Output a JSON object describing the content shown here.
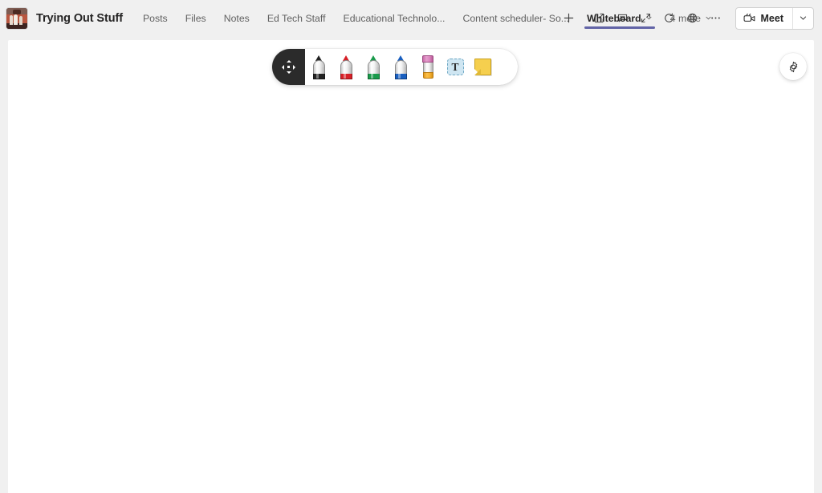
{
  "theme": {
    "accent": "#6264a7",
    "header_bg": "#f0f0f0",
    "canvas_bg": "#ffffff",
    "selected_tool_bg": "#2b2b2b"
  },
  "header": {
    "avatar_name": "team-photo-avatar",
    "team_name": "Trying Out Stuff",
    "tabs": [
      {
        "label": "Posts",
        "active": false,
        "has_chevron": false
      },
      {
        "label": "Files",
        "active": false,
        "has_chevron": false
      },
      {
        "label": "Notes",
        "active": false,
        "has_chevron": false
      },
      {
        "label": "Ed Tech Staff",
        "active": false,
        "has_chevron": false
      },
      {
        "label": "Educational Technolo...",
        "active": false,
        "has_chevron": false
      },
      {
        "label": "Content scheduler- So...",
        "active": false,
        "has_chevron": false
      },
      {
        "label": "Whiteboard",
        "active": true,
        "has_chevron": true
      },
      {
        "label": "4 more",
        "active": false,
        "has_chevron": true
      }
    ],
    "add_tab_label": "+",
    "chevron_glyph": "⌄",
    "actions": [
      {
        "name": "open-in-new-window-icon",
        "title": "Open in new window"
      },
      {
        "name": "chat-icon",
        "title": "Chat"
      },
      {
        "name": "expand-icon",
        "title": "Expand"
      },
      {
        "name": "refresh-icon",
        "title": "Refresh"
      },
      {
        "name": "globe-icon",
        "title": "Open in browser"
      },
      {
        "name": "more-options-icon",
        "title": "More options"
      }
    ],
    "meet": {
      "label": "Meet",
      "icon": "video-camera-icon",
      "dropdown_icon": "chevron-down-icon"
    }
  },
  "whiteboard": {
    "toolbar": {
      "tools": [
        {
          "name": "select-tool",
          "label": "Select",
          "icon": "move-arrows-icon",
          "selected": true,
          "color": ""
        },
        {
          "name": "pen-black-tool",
          "label": "Black pen",
          "icon": "marker-pen-icon",
          "selected": false,
          "color": "#222222"
        },
        {
          "name": "pen-red-tool",
          "label": "Red pen",
          "icon": "marker-pen-icon",
          "selected": false,
          "color": "#d62027"
        },
        {
          "name": "pen-green-tool",
          "label": "Green pen",
          "icon": "marker-pen-icon",
          "selected": false,
          "color": "#1a9a4b"
        },
        {
          "name": "pen-blue-tool",
          "label": "Blue pen",
          "icon": "marker-pen-icon",
          "selected": false,
          "color": "#1a5fbf"
        },
        {
          "name": "eraser-tool",
          "label": "Eraser",
          "icon": "eraser-icon",
          "selected": false,
          "color": ""
        },
        {
          "name": "text-tool",
          "label": "Text",
          "icon": "text-box-icon",
          "selected": false,
          "color": ""
        },
        {
          "name": "sticky-note-tool",
          "label": "Sticky note",
          "icon": "sticky-note-icon",
          "selected": false,
          "color": ""
        }
      ],
      "text_tool_glyph": "T"
    },
    "settings": {
      "name": "settings-gear-button",
      "icon": "gear-icon",
      "title": "Settings"
    },
    "canvas": {
      "name": "whiteboard-canvas",
      "content": ""
    }
  }
}
